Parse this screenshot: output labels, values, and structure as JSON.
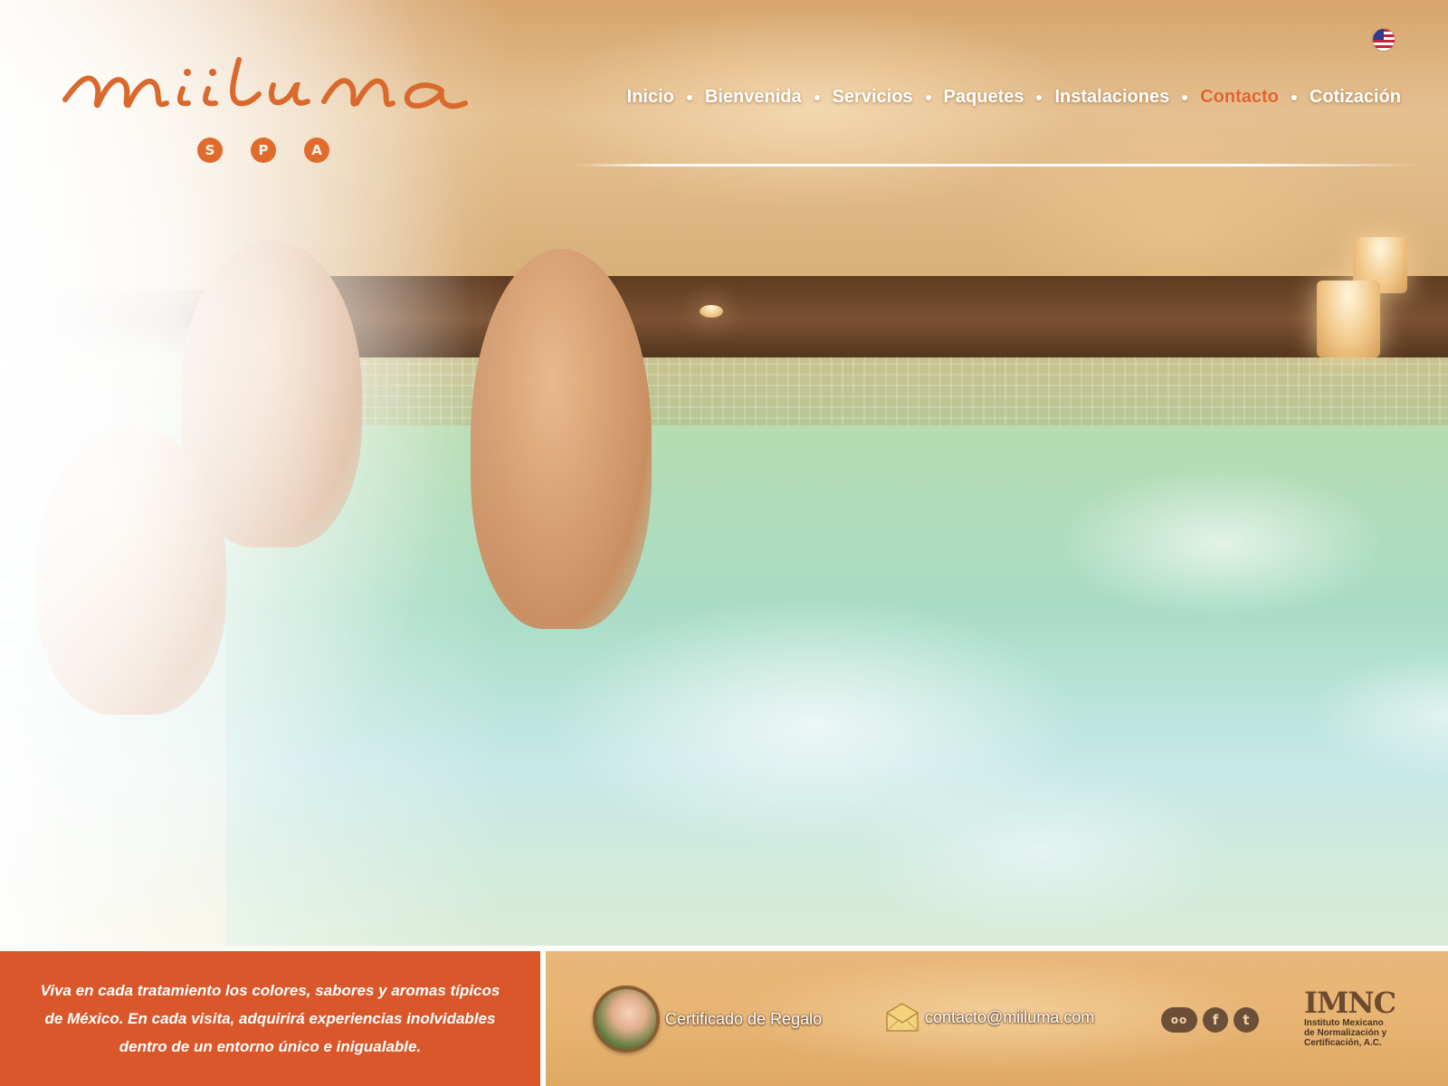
{
  "brand": {
    "name": "miiluma",
    "spa_letters": [
      "S",
      "P",
      "A"
    ],
    "accent_color": "#e06b2a"
  },
  "language_flag": {
    "icon": "us-flag-icon"
  },
  "nav": {
    "items": [
      {
        "label": "Inicio",
        "active": false
      },
      {
        "label": "Bienvenida",
        "active": false
      },
      {
        "label": "Servicios",
        "active": false
      },
      {
        "label": "Paquetes",
        "active": false
      },
      {
        "label": "Instalaciones",
        "active": false
      },
      {
        "label": "Contacto",
        "active": true
      },
      {
        "label": "Cotización",
        "active": false
      }
    ],
    "active_color": "#e2642a"
  },
  "footer": {
    "tagline": "Viva en cada tratamiento los colores, sabores y aromas típicos de México. En cada visita, adquirirá experiencias inolvidables dentro de un entorno único e inigualable.",
    "tagline_bg": "#d9572a",
    "gift_label": "Certificado de Regalo",
    "email": "contacto@miiluma.com",
    "social": [
      {
        "name": "tripadvisor-icon",
        "glyph": "oo"
      },
      {
        "name": "facebook-icon",
        "glyph": "f"
      },
      {
        "name": "twitter-icon",
        "glyph": "t"
      }
    ],
    "certification": {
      "logo_text": "IMNC",
      "text": "Instituto Mexicano\nde Normalización y\nCertificación, A.C."
    }
  }
}
